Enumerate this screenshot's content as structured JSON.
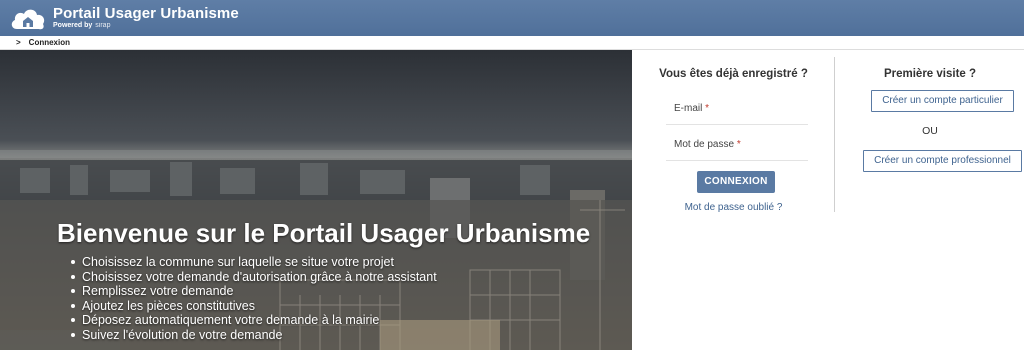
{
  "header": {
    "title": "Portail Usager Urbanisme",
    "powered_by": "Powered by",
    "powered_brand": "sirap",
    "bg_color": "#5b7aa3"
  },
  "breadcrumb": {
    "separator": ">",
    "current": "Connexion"
  },
  "hero": {
    "title": "Bienvenue sur le Portail Usager Urbanisme",
    "steps": [
      "Choisissez la commune sur laquelle se situe votre projet",
      "Choisissez votre demande d'autorisation grâce à notre assistant",
      "Remplissez votre demande",
      "Ajoutez les pièces constitutives",
      "Déposez automatiquement votre demande à la mairie",
      "Suivez l'évolution de votre demande"
    ]
  },
  "login": {
    "title": "Vous êtes déjà enregistré ?",
    "email_label": "E-mail",
    "password_label": "Mot de passe",
    "required_marker": "*",
    "submit_label": "CONNEXION",
    "forgot_label": "Mot de passe oublié ?",
    "accent_color": "#5a7aa3"
  },
  "register": {
    "title": "Première visite ?",
    "particulier_label": "Créer un compte particulier",
    "or_label": "OU",
    "pro_label": "Créer un compte professionnel"
  }
}
